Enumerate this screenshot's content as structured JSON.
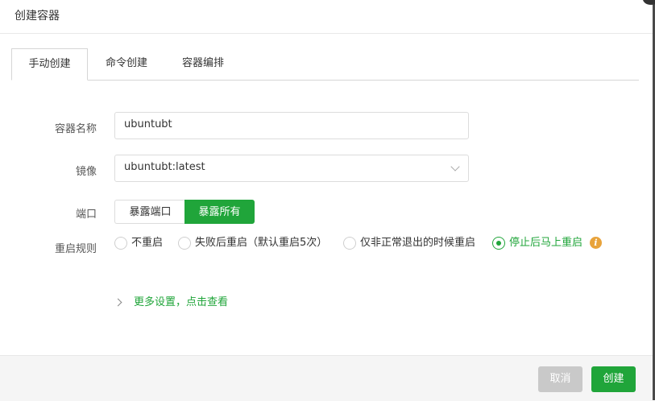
{
  "dialog": {
    "title": "创建容器"
  },
  "tabs": [
    {
      "label": "手动创建",
      "active": true
    },
    {
      "label": "命令创建",
      "active": false
    },
    {
      "label": "容器编排",
      "active": false
    }
  ],
  "form": {
    "name": {
      "label": "容器名称",
      "value": "ubuntubt"
    },
    "image": {
      "label": "镜像",
      "value": "ubuntubt:latest"
    },
    "port": {
      "label": "端口",
      "options": [
        "暴露端口",
        "暴露所有"
      ],
      "selected": "暴露所有"
    },
    "restart": {
      "label": "重启规则",
      "options": [
        "不重启",
        "失败后重启（默认重启5次）",
        "仅非正常退出的时候重启",
        "停止后马上重启"
      ],
      "selected": "停止后马上重启",
      "info_icon": "info-icon"
    },
    "more_settings": "更多设置，点击查看"
  },
  "footer": {
    "cancel_label": "取消",
    "create_label": "创建"
  },
  "colors": {
    "accent": "#20a53a",
    "disabled": "#c9c9c9",
    "info": "#e8a33b"
  }
}
